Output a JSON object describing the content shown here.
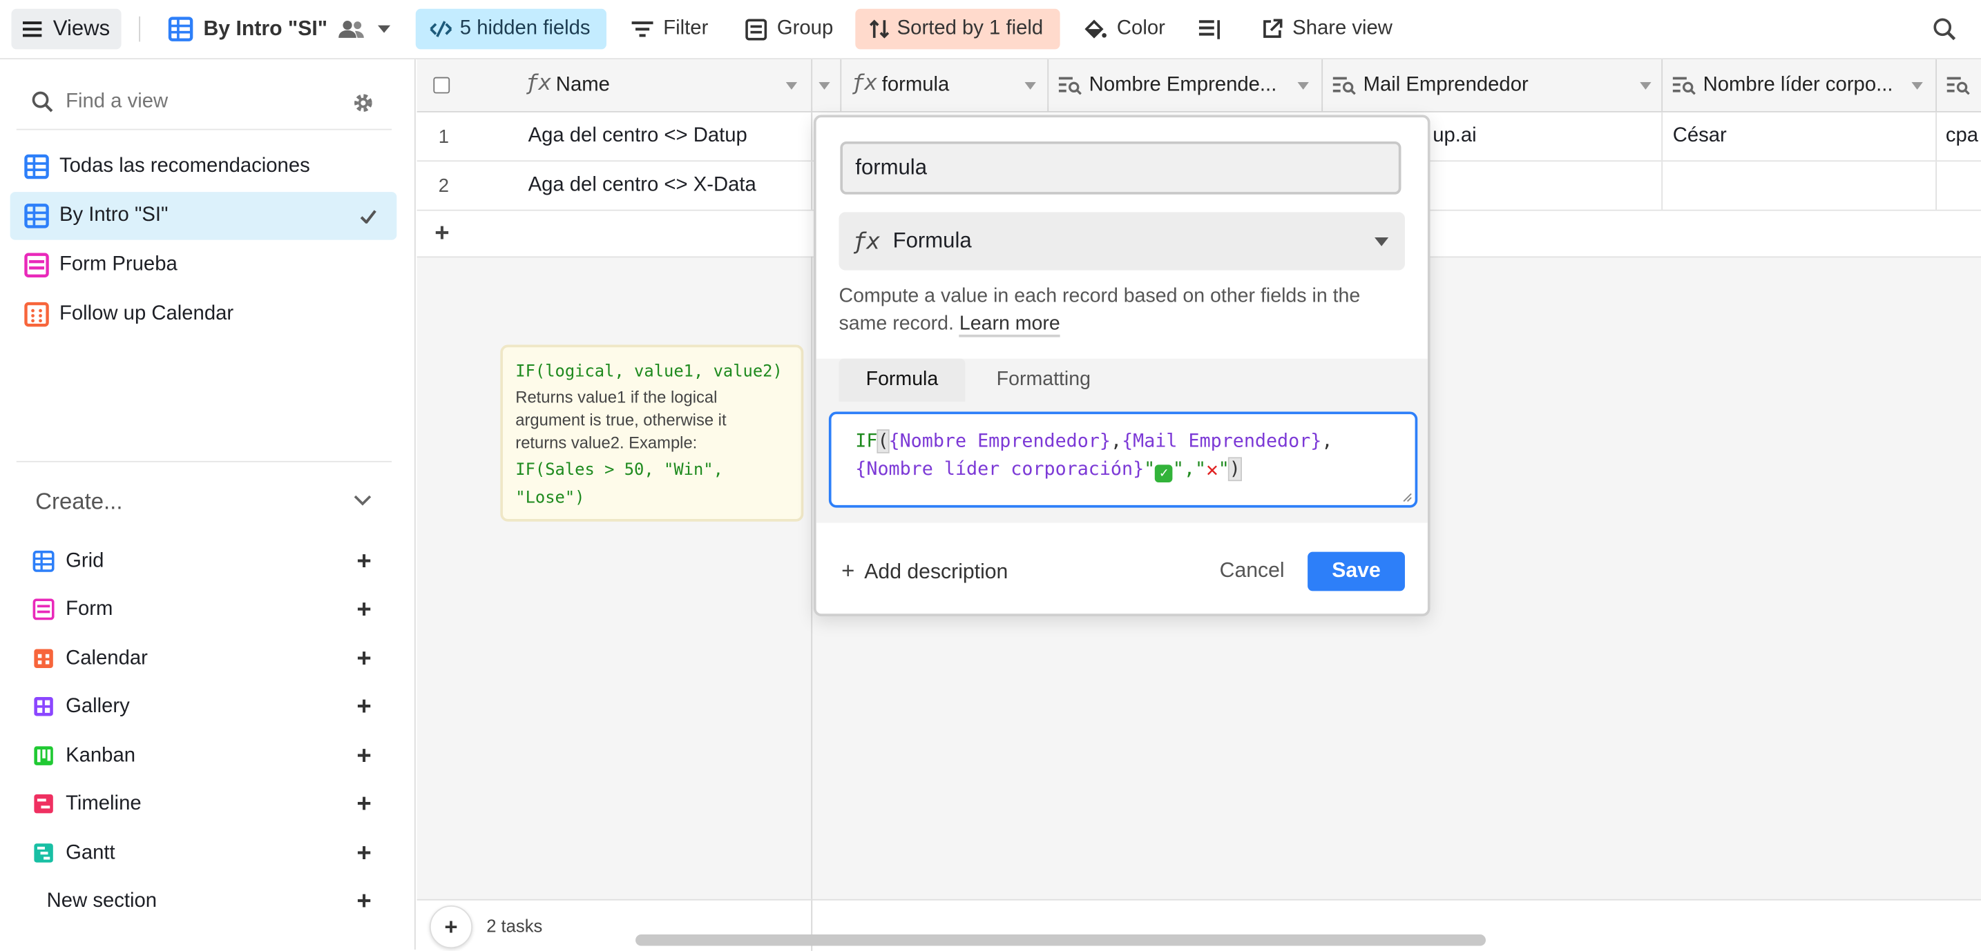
{
  "toolbar": {
    "views_label": "Views",
    "current_view": "By Intro \"SI\"",
    "hidden_fields": "5 hidden fields",
    "filter": "Filter",
    "group": "Group",
    "sorted": "Sorted by 1 field",
    "color": "Color",
    "share": "Share view"
  },
  "sidebar": {
    "search_placeholder": "Find a view",
    "views": [
      {
        "label": "Todas las recomendaciones",
        "type": "grid"
      },
      {
        "label": "By Intro \"SI\"",
        "type": "grid",
        "selected": true
      },
      {
        "label": "Form Prueba",
        "type": "form"
      },
      {
        "label": "Follow up Calendar",
        "type": "calendar"
      }
    ],
    "create_label": "Create...",
    "create_items": [
      {
        "label": "Grid",
        "color": "#2d7ff9"
      },
      {
        "label": "Form",
        "color": "#e929ba"
      },
      {
        "label": "Calendar",
        "color": "#f7653b"
      },
      {
        "label": "Gallery",
        "color": "#8b46ff"
      },
      {
        "label": "Kanban",
        "color": "#20c933"
      },
      {
        "label": "Timeline",
        "color": "#ef3061"
      },
      {
        "label": "Gantt",
        "color": "#18bfa4"
      }
    ],
    "new_section": "New section"
  },
  "grid": {
    "columns": [
      "Name",
      "formula",
      "Nombre Emprende...",
      "Mail Emprendedor",
      "Nombre líder corpo..."
    ],
    "rows": [
      {
        "num": "1",
        "name": "Aga del centro <> Datup",
        "mail": "up.ai",
        "lider": "César",
        "extra": "cpa"
      },
      {
        "num": "2",
        "name": "Aga del centro <> X-Data",
        "mail": "",
        "lider": "",
        "extra": ""
      }
    ],
    "footer_count": "2 tasks"
  },
  "tooltip": {
    "signature": "IF(logical, value1, value2)",
    "text_lines": [
      "Returns value1 if the logical",
      "argument is true, otherwise it",
      "returns value2. Example:"
    ],
    "example_lines": [
      "IF(Sales > 50, \"Win\",",
      "\"Lose\")"
    ]
  },
  "dialog": {
    "field_name": "formula",
    "field_type": "Formula",
    "description_text": "Compute a value in each record based on other fields in the same record.",
    "learn_more": "Learn more",
    "tab_formula": "Formula",
    "tab_formatting": "Formatting",
    "formula_line1": {
      "fn": "IF",
      "paren": "(",
      "f1": "{Nombre Emprendedor}",
      "c1": ",",
      "f2": "{Mail Emprendedor}",
      "c2": ","
    },
    "formula_line2": {
      "f3": "{Nombre líder corporación}",
      "q1": "\"",
      "q2": "\",\"",
      "q3": "\"",
      "close": ")"
    },
    "add_description": "Add description",
    "cancel": "Cancel",
    "save": "Save"
  },
  "colors": {
    "accent": "#2d7ff9",
    "hidden_bg": "#c4ecff",
    "sorted_bg": "#ffdacc"
  }
}
